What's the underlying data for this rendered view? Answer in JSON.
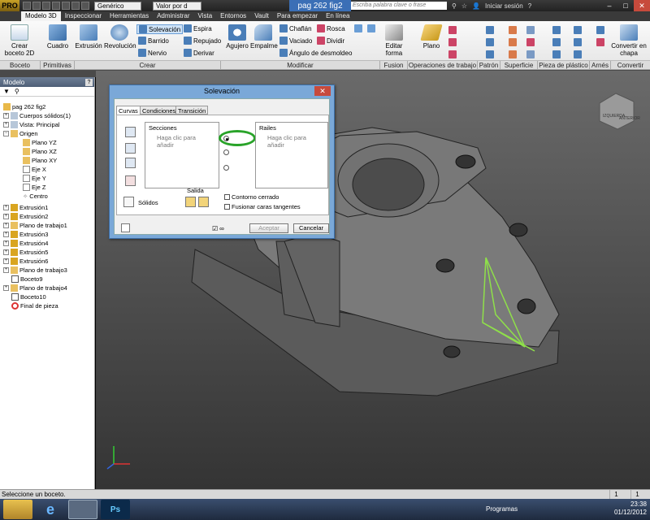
{
  "titlebar": {
    "app_logo": "PRO",
    "style_combo": "Genérico",
    "value_combo": "Valor por d",
    "doc_title": "pag 262 fig2",
    "search_placeholder": "Escriba palabra clave o frase",
    "signin": "Iniciar sesión"
  },
  "tabs": [
    "Modelo 3D",
    "Inspeccionar",
    "Herramientas",
    "Administrar",
    "Vista",
    "Entornos",
    "Vault",
    "Para empezar",
    "En línea"
  ],
  "ribbon": {
    "crear_boceto": "Crear boceto 2D",
    "cuadro": "Cuadro",
    "extrusion": "Extrusión",
    "revolucion": "Revolución",
    "solevacion": "Solevación",
    "barrido": "Barrido",
    "nervio": "Nervio",
    "espira": "Espira",
    "repujado": "Repujado",
    "derivar": "Derivar",
    "agujero": "Agujero",
    "empalme": "Empalme",
    "chaflan": "Chaflán",
    "vaciado": "Vaciado",
    "angulo": "Ángulo de desmoldeo",
    "rosca": "Rosca",
    "dividir": "Dividir",
    "editar_forma": "Editar forma",
    "plano": "Plano",
    "convertir": "Convertir en chapa",
    "panels": [
      "Boceto",
      "Primitivas",
      "Crear",
      "Modificar",
      "Fusion",
      "Operaciones de trabajo",
      "Patrón",
      "Superficie",
      "Pieza de plástico",
      "Arnés",
      "Convertir"
    ]
  },
  "browser": {
    "title": "Modelo",
    "items": [
      "pag 262 fig2",
      "Cuerpos sólidos(1)",
      "Vista: Principal",
      "Origen",
      "Plano YZ",
      "Plano XZ",
      "Plano XY",
      "Eje X",
      "Eje Y",
      "Eje Z",
      "Centro",
      "Extrusión1",
      "Extrusión2",
      "Plano de trabajo1",
      "Extrusión3",
      "Extrusión4",
      "Extrusión5",
      "Extrusión6",
      "Plano de trabajo3",
      "Boceto9",
      "Plano de trabajo4",
      "Boceto10",
      "Final de pieza"
    ]
  },
  "dialog": {
    "title": "Solevación",
    "tabs": [
      "Curvas",
      "Condiciones",
      "Transición"
    ],
    "secciones": "Secciones",
    "secciones_ph": "Haga clic para añadir",
    "railes": "Railes",
    "railes_ph": "Haga clic para añadir",
    "solidos": "Sólidos",
    "salida": "Salida",
    "contorno": "Contorno cerrado",
    "fusionar": "Fusionar caras tangentes",
    "aceptar": "Aceptar",
    "cancelar": "Cancelar"
  },
  "viewcube": {
    "left": "IZQUIERDA",
    "front": "ANTERIOR"
  },
  "status": {
    "text": "Seleccione un boceto.",
    "n1": "1",
    "n2": "1"
  },
  "taskbar": {
    "programs": "Programas",
    "time": "23:38",
    "date": "01/12/2012"
  }
}
